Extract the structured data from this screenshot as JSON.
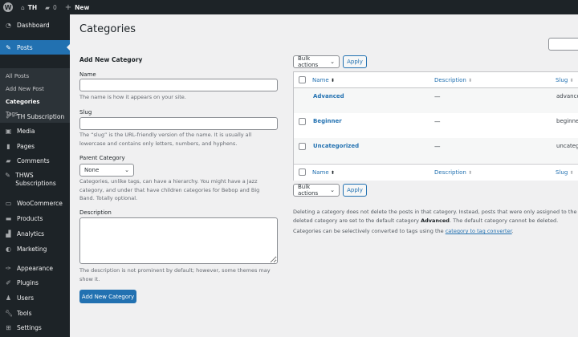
{
  "admin_bar": {
    "site": "TH",
    "comments_count": "0",
    "new_label": "New"
  },
  "sidebar": {
    "dashboard": "Dashboard",
    "posts": "Posts",
    "submenu": [
      "All Posts",
      "Add New Post",
      "Categories",
      "Tags"
    ],
    "items": [
      "TH Subscription",
      "Media",
      "Pages",
      "Comments",
      "THWS Subscriptions",
      "WooCommerce",
      "Products",
      "Analytics",
      "Marketing",
      "Appearance",
      "Plugins",
      "Users",
      "Tools",
      "Settings"
    ]
  },
  "page_title": "Categories",
  "form": {
    "heading": "Add New Category",
    "name_label": "Name",
    "name_value": "",
    "name_help": "The name is how it appears on your site.",
    "slug_label": "Slug",
    "slug_value": "",
    "slug_help": "The “slug” is the URL-friendly version of the name. It is usually all lowercase and contains only letters, numbers, and hyphens.",
    "parent_label": "Parent Category",
    "parent_value": "None",
    "parent_help": "Categories, unlike tags, can have a hierarchy. You might have a Jazz category, and under that have children categories for Bebop and Big Band. Totally optional.",
    "description_label": "Description",
    "description_value": "",
    "description_help": "The description is not prominent by default; however, some themes may show it.",
    "submit": "Add New Category"
  },
  "table": {
    "bulk_actions": "Bulk actions",
    "apply": "Apply",
    "columns": [
      "Name",
      "Description",
      "Slug"
    ],
    "rows": [
      {
        "name": "Advanced",
        "description": "—",
        "slug": "advanced"
      },
      {
        "name": "Beginner",
        "description": "—",
        "slug": "beginner"
      },
      {
        "name": "Uncategorized",
        "description": "—",
        "slug": "uncategorized"
      }
    ]
  },
  "notes": {
    "delete_note_1": "Deleting a category does not delete the posts in that category. Instead, posts that were only assigned to the deleted category are set to the default category ",
    "default_category": "Advanced",
    "delete_note_2": ". The default category cannot be deleted.",
    "convert_note": "Categories can be selectively converted to tags using the ",
    "convert_link": "category to tag converter",
    "convert_end": "."
  },
  "colors": {
    "accent": "#2271b1",
    "sidebar_bg": "#1d2327",
    "page_bg": "#f0f0f1"
  }
}
